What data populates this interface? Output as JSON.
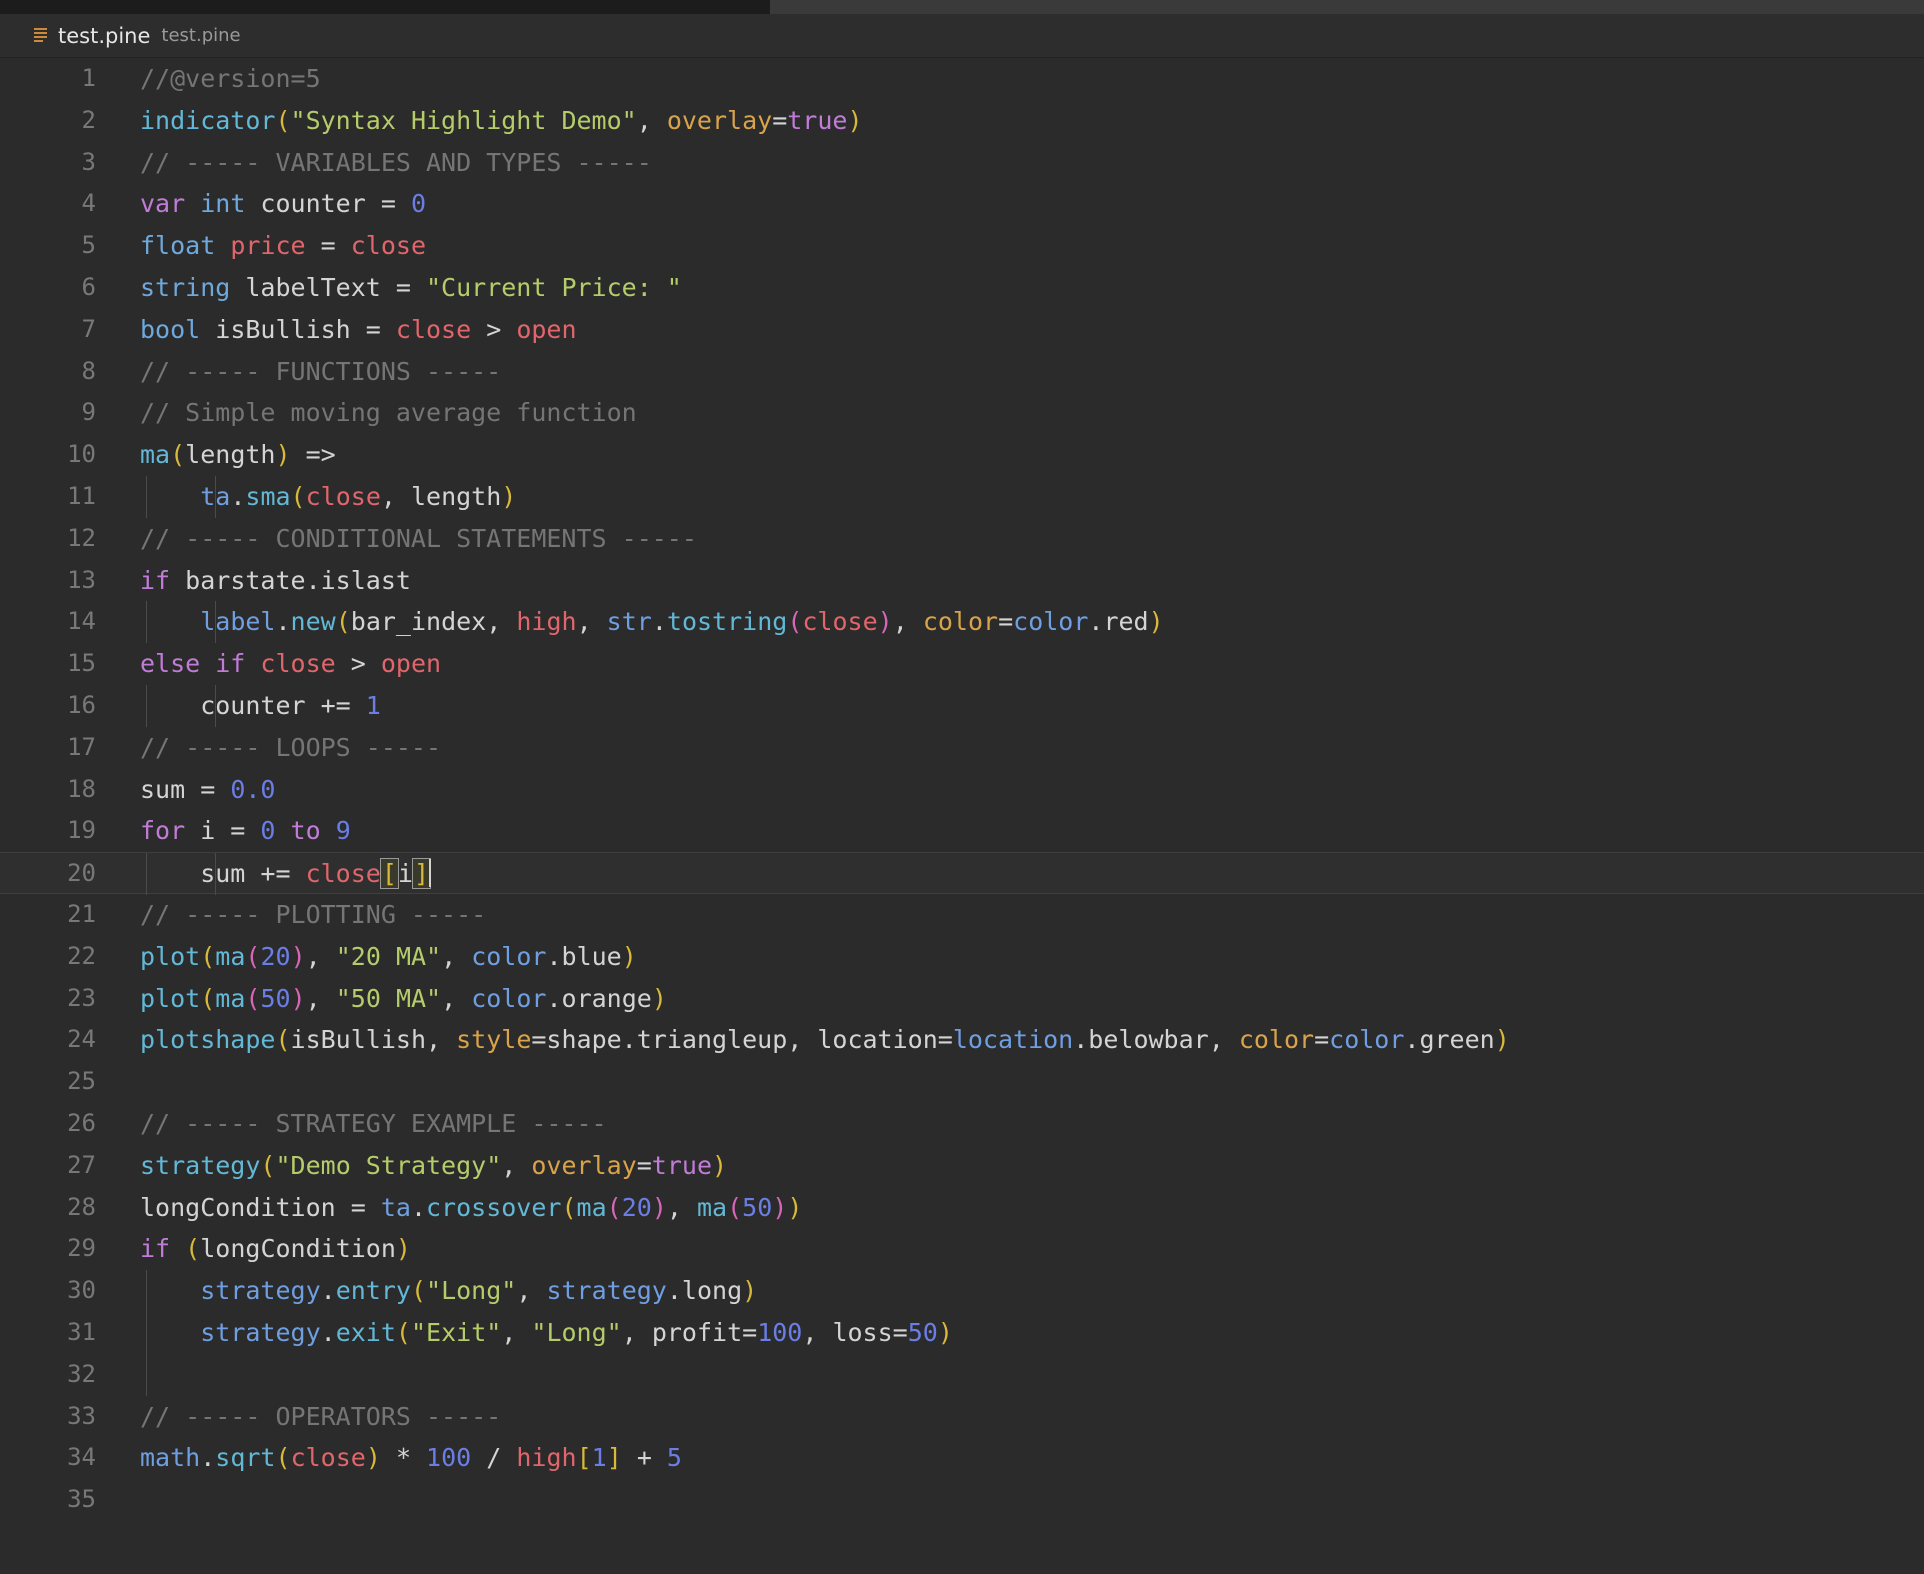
{
  "window": {
    "background_color": "#2b2b2b",
    "editor_background": "#2b2b2b"
  },
  "tabbar": {
    "icon": "pine-file-icon",
    "title": "test.pine",
    "subtitle": "test.pine"
  },
  "editor": {
    "language": "Pine Script",
    "cursor_line": 20,
    "total_lines": 35,
    "colors": {
      "comment": "#757575",
      "keyword": "#c07cd6",
      "type": "#6fa8dc",
      "function": "#62b8d6",
      "namespace": "#6f9fe0",
      "builtin_var": "#e0666c",
      "string": "#b5cc6a",
      "number": "#6a7ee6",
      "paren_level1": "#d8b93a",
      "paren_level2": "#d667b8",
      "named_arg": "#d9a34a",
      "plain": "#d4d4d4"
    },
    "lines": [
      {
        "n": "1",
        "text": "//@version=5"
      },
      {
        "n": "2",
        "text": "indicator(\"Syntax Highlight Demo\", overlay=true)"
      },
      {
        "n": "3",
        "text": "// ----- VARIABLES AND TYPES -----"
      },
      {
        "n": "4",
        "text": "var int counter = 0"
      },
      {
        "n": "5",
        "text": "float price = close"
      },
      {
        "n": "6",
        "text": "string labelText = \"Current Price: \""
      },
      {
        "n": "7",
        "text": "bool isBullish = close > open"
      },
      {
        "n": "8",
        "text": "// ----- FUNCTIONS -----"
      },
      {
        "n": "9",
        "text": "// Simple moving average function"
      },
      {
        "n": "10",
        "text": "ma(length) =>"
      },
      {
        "n": "11",
        "text": "    ta.sma(close, length)"
      },
      {
        "n": "12",
        "text": "// ----- CONDITIONAL STATEMENTS -----"
      },
      {
        "n": "13",
        "text": "if barstate.islast"
      },
      {
        "n": "14",
        "text": "    label.new(bar_index, high, str.tostring(close), color=color.red)"
      },
      {
        "n": "15",
        "text": "else if close > open"
      },
      {
        "n": "16",
        "text": "    counter += 1"
      },
      {
        "n": "17",
        "text": "// ----- LOOPS -----"
      },
      {
        "n": "18",
        "text": "sum = 0.0"
      },
      {
        "n": "19",
        "text": "for i = 0 to 9"
      },
      {
        "n": "20",
        "text": "    sum += close[i]"
      },
      {
        "n": "21",
        "text": "// ----- PLOTTING -----"
      },
      {
        "n": "22",
        "text": "plot(ma(20), \"20 MA\", color.blue)"
      },
      {
        "n": "23",
        "text": "plot(ma(50), \"50 MA\", color.orange)"
      },
      {
        "n": "24",
        "text": "plotshape(isBullish, style=shape.triangleup, location=location.belowbar, color=color.green)"
      },
      {
        "n": "25",
        "text": ""
      },
      {
        "n": "26",
        "text": "// ----- STRATEGY EXAMPLE -----"
      },
      {
        "n": "27",
        "text": "strategy(\"Demo Strategy\", overlay=true)"
      },
      {
        "n": "28",
        "text": "longCondition = ta.crossover(ma(20), ma(50))"
      },
      {
        "n": "29",
        "text": "if (longCondition)"
      },
      {
        "n": "30",
        "text": "    strategy.entry(\"Long\", strategy.long)"
      },
      {
        "n": "31",
        "text": "    strategy.exit(\"Exit\", \"Long\", profit=100, loss=50)"
      },
      {
        "n": "32",
        "text": ""
      },
      {
        "n": "33",
        "text": "// ----- OPERATORS -----"
      },
      {
        "n": "34",
        "text": "math.sqrt(close) * 100 / high[1] + 5"
      },
      {
        "n": "35",
        "text": ""
      }
    ]
  }
}
